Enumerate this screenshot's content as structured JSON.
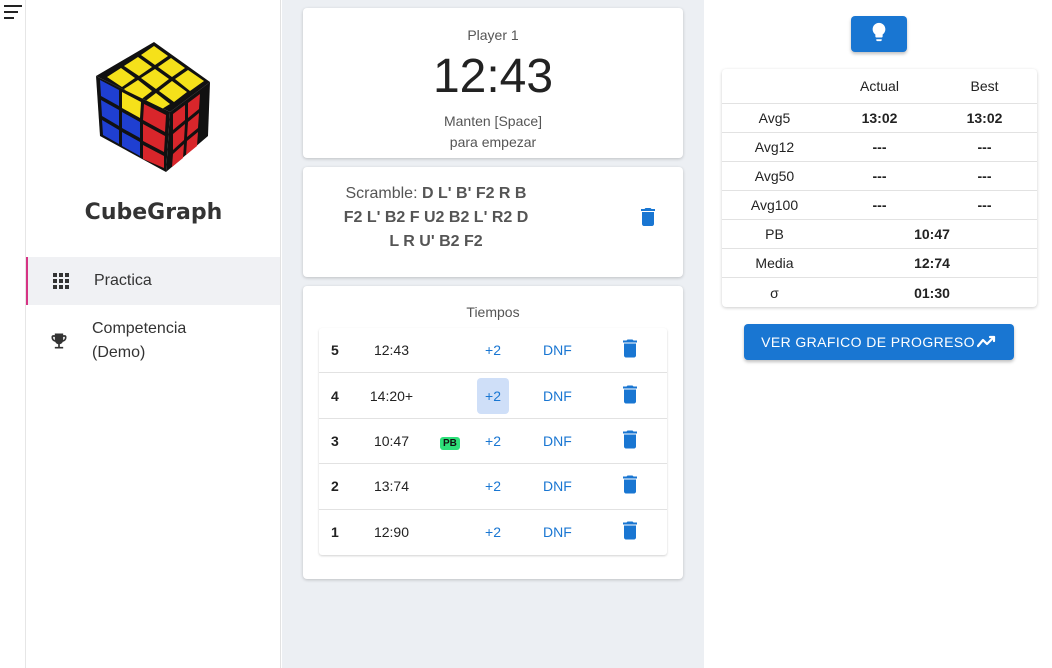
{
  "app": {
    "name": "CubeGraph"
  },
  "sidebar": {
    "items": [
      {
        "label": "Practica",
        "icon": "grid-icon",
        "active": true
      },
      {
        "label": "Competencia (Demo)",
        "line1": "Competencia",
        "line2": "(Demo)",
        "icon": "trophy-icon",
        "active": false
      }
    ]
  },
  "timer": {
    "player": "Player 1",
    "time": "12:43",
    "hint_line1": "Manten [Space]",
    "hint_line2": "para empezar"
  },
  "scramble": {
    "label": "Scramble:",
    "moves_line1": "D L' B' F2 R B",
    "moves_line2": "F2 L' B2 F U2 B2 L' R2 D",
    "moves_line3": "L R U' B2 F2"
  },
  "times": {
    "title": "Tiempos",
    "plus2_label": "+2",
    "dnf_label": "DNF",
    "pb_badge": "PB",
    "rows": [
      {
        "index": "5",
        "time": "12:43",
        "pb": false,
        "plus2_active": false
      },
      {
        "index": "4",
        "time": "14:20+",
        "pb": false,
        "plus2_active": true
      },
      {
        "index": "3",
        "time": "10:47",
        "pb": true,
        "plus2_active": false
      },
      {
        "index": "2",
        "time": "13:74",
        "pb": false,
        "plus2_active": false
      },
      {
        "index": "1",
        "time": "12:90",
        "pb": false,
        "plus2_active": false
      }
    ]
  },
  "stats": {
    "headers": {
      "actual": "Actual",
      "best": "Best"
    },
    "rows": [
      {
        "label": "Avg5",
        "actual": "13:02",
        "best": "13:02"
      },
      {
        "label": "Avg12",
        "actual": "---",
        "best": "---"
      },
      {
        "label": "Avg50",
        "actual": "---",
        "best": "---"
      },
      {
        "label": "Avg100",
        "actual": "---",
        "best": "---"
      },
      {
        "label": "PB",
        "value": "10:47"
      },
      {
        "label": "Media",
        "value": "12:74"
      },
      {
        "label": "σ",
        "value": "01:30"
      }
    ]
  },
  "actions": {
    "graph_button": "VER GRAFICO DE PROGRESO",
    "tip_icon": "lightbulb-icon",
    "graph_icon": "trending-icon"
  },
  "colors": {
    "primary": "#1976d2",
    "active_accent": "#d63384",
    "pb_badge": "#2ee07a"
  }
}
